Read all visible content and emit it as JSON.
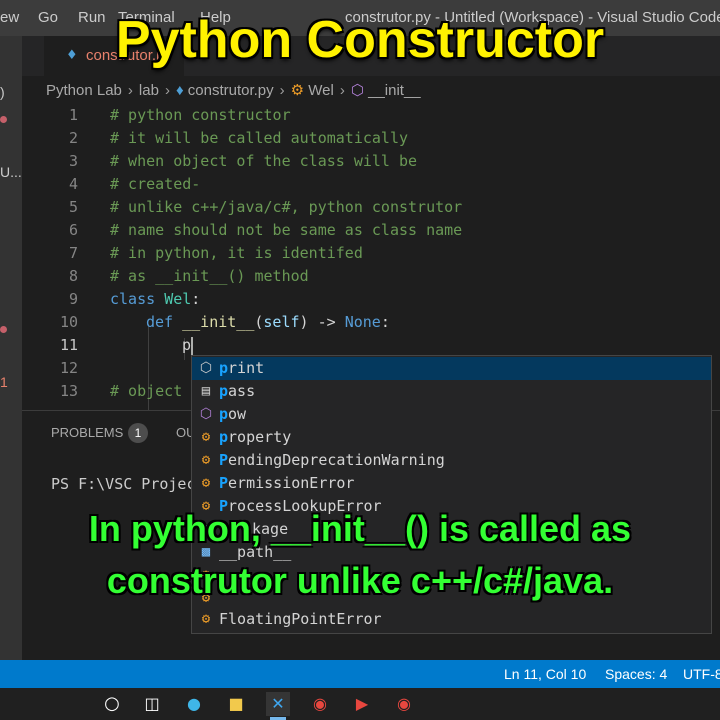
{
  "titlebar": {
    "menu": [
      "ew",
      "Go",
      "Run",
      "Terminal",
      "Help"
    ],
    "window_title": "construtor.py - Untitled (Workspace) - Visual Studio Code"
  },
  "activitybar": {
    "fragments": [
      ")",
      "U...",
      "1"
    ]
  },
  "tab": {
    "name": "construtor.py"
  },
  "breadcrumb": [
    "Python Lab",
    "lab",
    "construtor.py",
    "Wel",
    "__init__"
  ],
  "editor": {
    "lines": [
      {
        "n": "1",
        "text": "# python constructor"
      },
      {
        "n": "2",
        "text": "# it will be called automatically"
      },
      {
        "n": "3",
        "text": "# when object of the class will be"
      },
      {
        "n": "4",
        "text": "# created-"
      },
      {
        "n": "5",
        "text": "# unlike c++/java/c#, python construtor"
      },
      {
        "n": "6",
        "text": "# name should not be same as class name"
      },
      {
        "n": "7",
        "text": "# in python, it is identifed"
      },
      {
        "n": "8",
        "text": "# as __init__() method"
      },
      {
        "n": "9",
        "text": "class Wel:"
      },
      {
        "n": "10",
        "text": "def __init__(self) -> None:"
      },
      {
        "n": "11",
        "text": "p"
      },
      {
        "n": "12",
        "text": ""
      },
      {
        "n": "13",
        "text": "# object"
      }
    ],
    "tokens": {
      "class_kw": "class",
      "class_name": "Wel",
      "colon": ":",
      "def_kw": "def",
      "init": "__init__",
      "open": "(",
      "self": "self",
      "close": ")",
      "arrow": " -> ",
      "none": "None",
      "colon2": ":",
      "typed": "p",
      "comment13": "# object"
    }
  },
  "suggestions": [
    {
      "icon": "keyword-icon",
      "match": "p",
      "rest": "rint",
      "selected": true
    },
    {
      "icon": "snippet-icon",
      "match": "p",
      "rest": "ass"
    },
    {
      "icon": "function-icon",
      "match": "p",
      "rest": "ow"
    },
    {
      "icon": "class-icon",
      "match": "p",
      "rest": "roperty"
    },
    {
      "icon": "class-icon",
      "match": "P",
      "rest": "endingDeprecationWarning"
    },
    {
      "icon": "class-icon",
      "match": "P",
      "rest": "ermissionError"
    },
    {
      "icon": "class-icon",
      "match": "P",
      "rest": "rocessLookupError"
    },
    {
      "icon": "module-icon",
      "match": "",
      "rest": "kage"
    },
    {
      "icon": "variable-icon",
      "match": "",
      "rest": "__path__"
    },
    {
      "icon": "class-icon",
      "match": "",
      "rest": ""
    },
    {
      "icon": "class-icon",
      "match": "",
      "rest": ""
    },
    {
      "icon": "class-icon",
      "match": "",
      "rest": "FloatingPointError"
    }
  ],
  "panel": {
    "problems_label": "PROBLEMS",
    "problems_count": "1",
    "output_label": "OU",
    "terminal_prompt": "PS F:\\VSC Projec"
  },
  "statusbar": {
    "position": "Ln 11, Col 10",
    "spaces": "Spaces: 4",
    "encoding": "UTF-8"
  },
  "overlay": {
    "title": "Python Constructor",
    "caption_line1": "In python, __init__() is called as",
    "caption_line2": "construtor unlike c++/c#/java."
  },
  "colors": {
    "title_yellow": "#fff200",
    "caption_green": "#33ff33",
    "status_blue": "#007acc",
    "comment_green": "#6a9955",
    "keyword_blue": "#569cd6"
  }
}
